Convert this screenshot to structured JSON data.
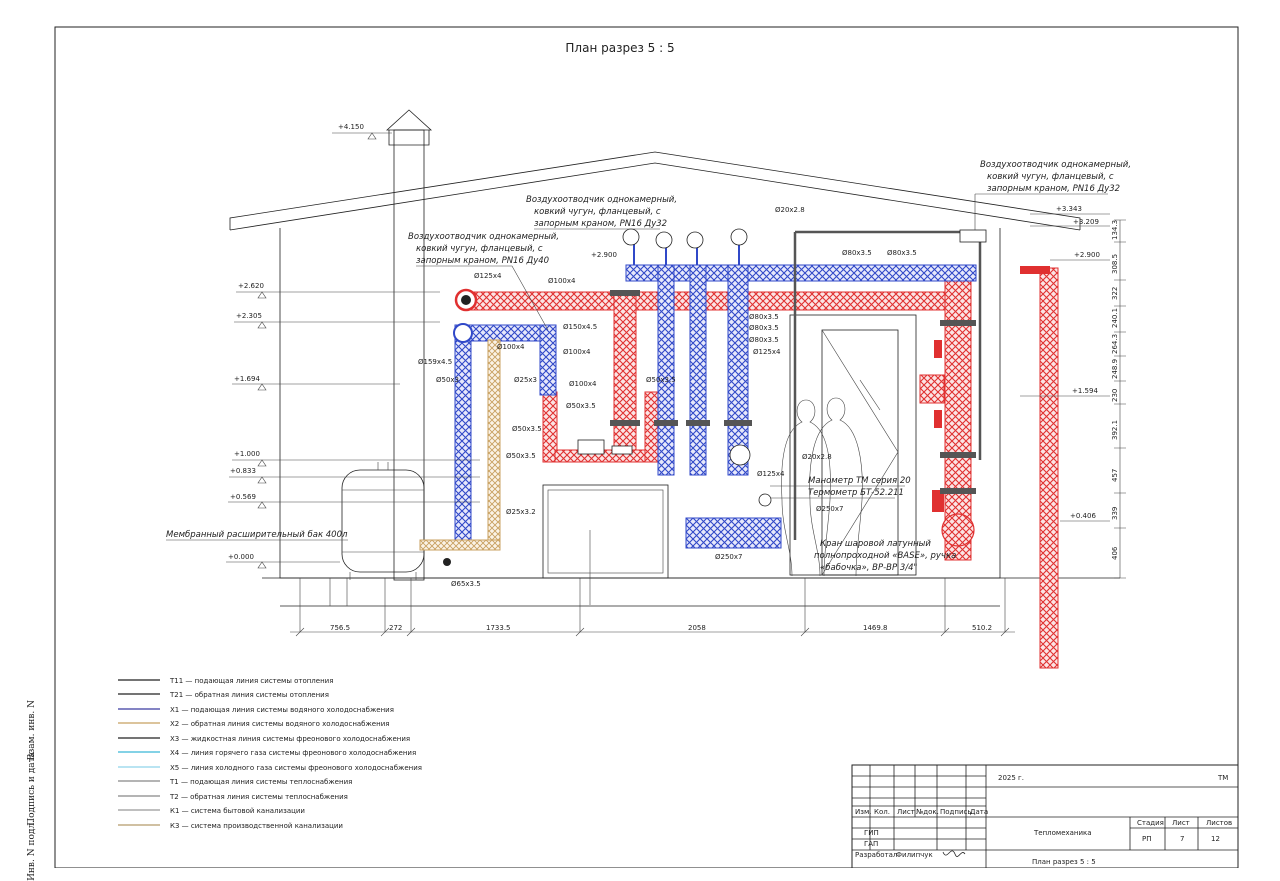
{
  "title": "План разрез 5 : 5",
  "elevations": [
    "+4.150",
    "+2.620",
    "+2.305",
    "+1.694",
    "+1.000",
    "+0.833",
    "+0.569",
    "+0.000",
    "+3.343",
    "+3.209",
    "+2.900",
    "+2.900",
    "+1.594",
    "+0.406"
  ],
  "right_dims": [
    "134.3",
    "308.5",
    "322",
    "240.1",
    "264.3",
    "248.9",
    "230",
    "392.1",
    "457",
    "339",
    "406"
  ],
  "bottom_dims": [
    "756.5",
    "272",
    "1733.5",
    "2058",
    "1469.8",
    "510.2"
  ],
  "callouts": {
    "deaerator_left": [
      "Воздухоотводчик однокамерный,",
      "ковкий чугун, фланцевый, с",
      "запорным краном, PN16 Ду40"
    ],
    "deaerator_mid": [
      "Воздухоотводчик однокамерный,",
      "ковкий чугун, фланцевый, с",
      "запорным краном, PN16 Ду32"
    ],
    "deaerator_right": [
      "Воздухоотводчик однокамерный,",
      "ковкий чугун, фланцевый, с",
      "запорным краном, PN16 Ду32"
    ],
    "tank": "Мембранный расширительный бак 400л",
    "manometer": "Манометр ТМ серия 20",
    "thermometer": "Термометр БТ-52.211",
    "valve": [
      "Кран шаровой латунный",
      "полнопроходной «BASE», ручка",
      "«бабочка», ВР-ВР 3/4\""
    ]
  },
  "pipe_labels": [
    "Ø125х4",
    "Ø100х4",
    "Ø150х4.5",
    "Ø100х4",
    "Ø100х4",
    "Ø100х4",
    "Ø25х3",
    "Ø50х3",
    "Ø50х3.5",
    "Ø50х3.5",
    "Ø50х3.5",
    "Ø50х3.5",
    "Ø25х3.2",
    "Ø65х3.5",
    "Ø159х4.5",
    "Ø20х2.8",
    "Ø80х3.5",
    "Ø80х3.5",
    "Ø80х3.5",
    "Ø80х3.5",
    "Ø80х3.5",
    "Ø125х4",
    "Ø20х2.8",
    "Ø125х4",
    "Ø250х7",
    "Ø250х7"
  ],
  "legend": [
    {
      "code": "Т11",
      "text": "Т11 — подающая линия системы отопления",
      "color": "#222222"
    },
    {
      "code": "Т21",
      "text": "Т21 — обратная линия системы отопления",
      "color": "#222222"
    },
    {
      "code": "Х1",
      "text": "Х1 — подающая линия системы водяного холодоснабжения",
      "color": "#3a3aa0"
    },
    {
      "code": "Х2",
      "text": "Х2 — обратная линия системы водяного холодоснабжения",
      "color": "#c8a060"
    },
    {
      "code": "Х3",
      "text": "Х3 — жидкостная линия системы фреонового холодоснабжения",
      "color": "#222222"
    },
    {
      "code": "Х4",
      "text": "Х4 — линия горячего газа системы фреонового холодоснабжения",
      "color": "#39b6d8"
    },
    {
      "code": "Х5",
      "text": "Х5 — линия холодного газа системы фреонового холодоснабжения",
      "color": "#8fd3ea"
    },
    {
      "code": "Т1",
      "text": "Т1 — подающая линия системы теплоснабжения",
      "color": "#888888"
    },
    {
      "code": "Т2",
      "text": "Т2 — обратная линия системы теплоснабжения",
      "color": "#888888"
    },
    {
      "code": "К1",
      "text": "К1 — система бытовой канализации",
      "color": "#999999"
    },
    {
      "code": "К3",
      "text": "К3 — система производственной канализации",
      "color": "#b59a6a"
    }
  ],
  "stamp": {
    "year": "2025 г.",
    "section": "ТМ",
    "headers": [
      "Изм.",
      "Кол.",
      "Лист",
      "№док.",
      "Подпись",
      "Дата"
    ],
    "roles": [
      "ГИП",
      "ГАП",
      "Разработал"
    ],
    "developer_name": "Филипчук",
    "project_name": "Тепломеханика",
    "stage_label": "Стадия",
    "sheet_label": "Лист",
    "sheets_label": "Листов",
    "stage": "РП",
    "sheet": "7",
    "sheets": "12",
    "drawing_name": "План разрез 5 : 5"
  },
  "side_strip": [
    "Взам. инв. N",
    "Подпись и дата",
    "Инв. N подл."
  ],
  "colors": {
    "supply": "#e03030",
    "return": "#3048c8",
    "frame": "#222222"
  }
}
